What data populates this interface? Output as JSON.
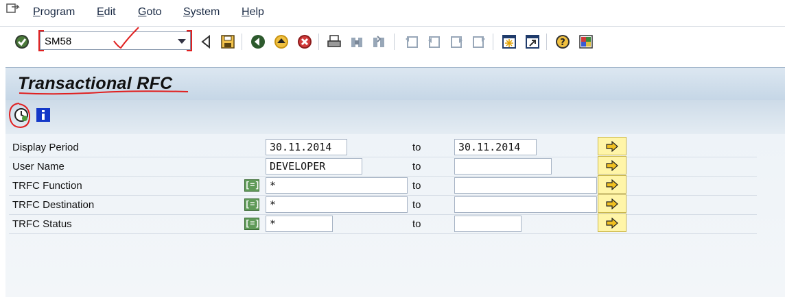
{
  "menu": {
    "items": [
      {
        "label": "Program",
        "underline": "P",
        "rest": "rogram"
      },
      {
        "label": "Edit",
        "underline": "E",
        "rest": "dit"
      },
      {
        "label": "Goto",
        "underline": "G",
        "rest": "oto"
      },
      {
        "label": "System",
        "underline": "S",
        "rest": "ystem"
      },
      {
        "label": "Help",
        "underline": "H",
        "rest": "elp"
      }
    ]
  },
  "toolbar": {
    "command_value": "SM58",
    "icons": [
      "enter-check-icon",
      "command-field",
      "back-triangle-icon",
      "save-icon",
      "back-icon",
      "exit-icon",
      "cancel-icon",
      "print-icon",
      "find-icon",
      "find-next-icon",
      "first-page-icon",
      "previous-page-icon",
      "next-page-icon",
      "last-page-icon",
      "create-session-icon",
      "shortcut-icon",
      "help-icon",
      "layout-icon"
    ]
  },
  "title": "Transactional RFC",
  "app_toolbar": {
    "icons": [
      "execute-clock-icon",
      "information-icon"
    ]
  },
  "form": {
    "to_label": "to",
    "rows": [
      {
        "label": "Display Period",
        "from": "30.11.2014",
        "to": "30.11.2014",
        "has_selection_option": false
      },
      {
        "label": "User Name",
        "from": "DEVELOPER",
        "to": "",
        "has_selection_option": false
      },
      {
        "label": "TRFC Function",
        "from": "*",
        "to": "",
        "has_selection_option": true
      },
      {
        "label": "TRFC Destination",
        "from": "*",
        "to": "",
        "has_selection_option": true
      },
      {
        "label": "TRFC Status",
        "from": "*",
        "to": "",
        "has_selection_option": true
      }
    ],
    "selection_option_glyph": "[=]"
  },
  "colors": {
    "accent_red": "#e02020",
    "title_bar": "#c5d6e6",
    "multiple_selection_button": "#fff5a8",
    "selection_option": "#5f9a58"
  }
}
